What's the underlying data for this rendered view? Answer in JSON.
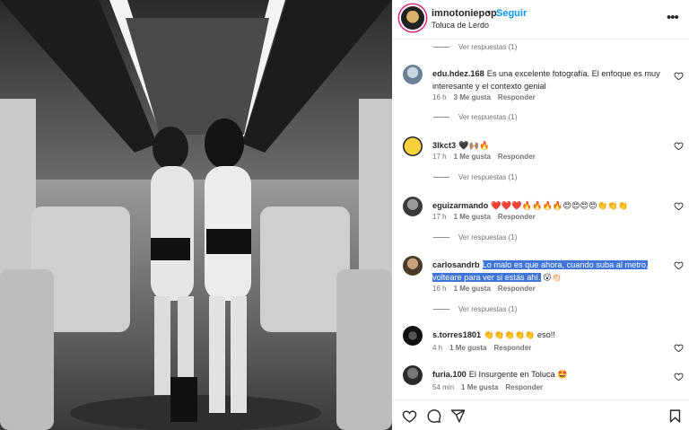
{
  "post": {
    "username": "imnotoniepop",
    "separator": "•",
    "follow_label": "Seguir",
    "location": "Toluca de Lerdo",
    "more_label": "•••"
  },
  "comments": [
    {
      "view_replies": "Ver respuestas (1)"
    },
    {
      "user": "edu.hdez.168",
      "text": "Es una excelente fotografía. El enfoque es muy interesante y el contexto genial",
      "time": "16 h",
      "likes": "3 Me gusta",
      "reply": "Responder",
      "view_replies": "Ver respuestas (1)"
    },
    {
      "user": "3lkct3",
      "text": "🖤🙌🏽🔥",
      "time": "17 h",
      "likes": "1 Me gusta",
      "reply": "Responder",
      "view_replies": "Ver respuestas (1)"
    },
    {
      "user": "eguizarmando",
      "text": "❤️❤️❤️🔥🔥🔥🔥😍😍😍😍👏👏👏",
      "time": "17 h",
      "likes": "1 Me gusta",
      "reply": "Responder",
      "view_replies": "Ver respuestas (1)"
    },
    {
      "user": "carlosandrb",
      "text": "Lo malo es que ahora, cuando suba al metro, volteare para ver si estás ahí.",
      "emoji": "😮👏🏻",
      "time": "16 h",
      "likes": "1 Me gusta",
      "reply": "Responder",
      "view_replies": "Ver respuestas (1)"
    },
    {
      "user": "s.torres1801",
      "text": "👏👏👏👏👏 eso!!",
      "time": "4 h",
      "likes": "1 Me gusta",
      "reply": "Responder"
    },
    {
      "user": "furia.100",
      "text": "El Insurgente en Toluca 🤩",
      "time": "54 min",
      "likes": "1 Me gusta",
      "reply": "Responder"
    }
  ],
  "icons": [
    "heart-icon",
    "comment-icon",
    "share-icon",
    "bookmark-icon",
    "more-icon"
  ],
  "colors": {
    "link": "#0095f6",
    "highlight": "#3f74d9",
    "muted": "#737373"
  }
}
